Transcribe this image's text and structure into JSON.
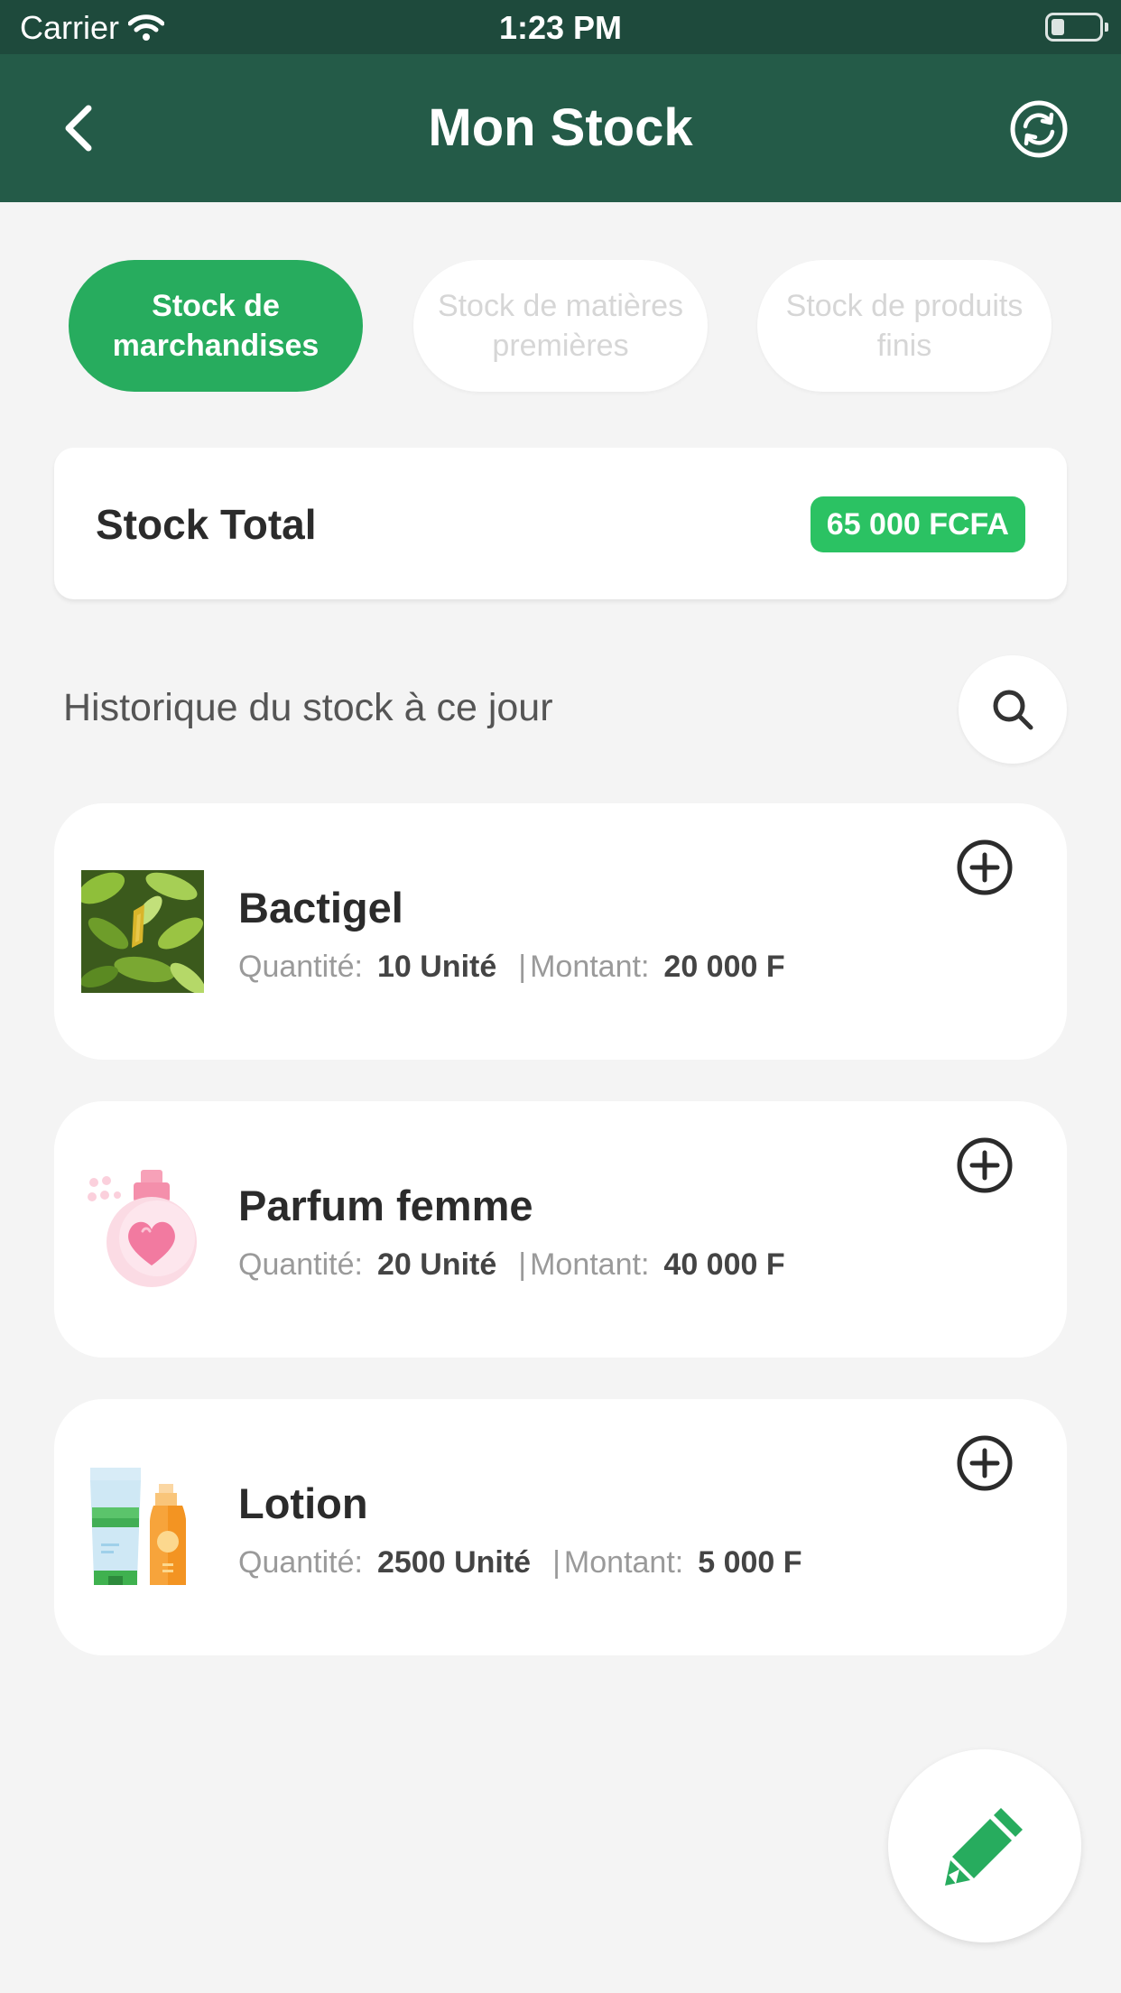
{
  "status_bar": {
    "carrier": "Carrier",
    "time": "1:23 PM"
  },
  "header": {
    "title": "Mon Stock"
  },
  "tabs": [
    {
      "label": "Stock de marchandises",
      "active": true
    },
    {
      "label": "Stock de matières premières",
      "active": false
    },
    {
      "label": "Stock de produits finis",
      "active": false
    }
  ],
  "total": {
    "label": "Stock Total",
    "value": "65 000 FCFA"
  },
  "history": {
    "label": "Historique du stock à ce jour"
  },
  "meta_labels": {
    "quantity": "Quantité:",
    "amount": "Montant:",
    "separator": "|"
  },
  "items": [
    {
      "name": "Bactigel",
      "quantity": "10 Unité",
      "amount": "20 000 F",
      "image": "plant-photo"
    },
    {
      "name": "Parfum femme",
      "quantity": "20 Unité",
      "amount": "40 000 F",
      "image": "perfume-icon"
    },
    {
      "name": "Lotion",
      "quantity": "2500 Unité",
      "amount": "5 000 F",
      "image": "lotion-icon"
    }
  ],
  "colors": {
    "header": "#245b48",
    "status_bar": "#1e4a3c",
    "accent": "#27ac5e",
    "badge": "#2bc263"
  },
  "icons": {
    "back": "chevron-left-icon",
    "refresh": "refresh-icon",
    "search": "search-icon",
    "add": "plus-circle-icon",
    "edit": "pencil-icon"
  }
}
